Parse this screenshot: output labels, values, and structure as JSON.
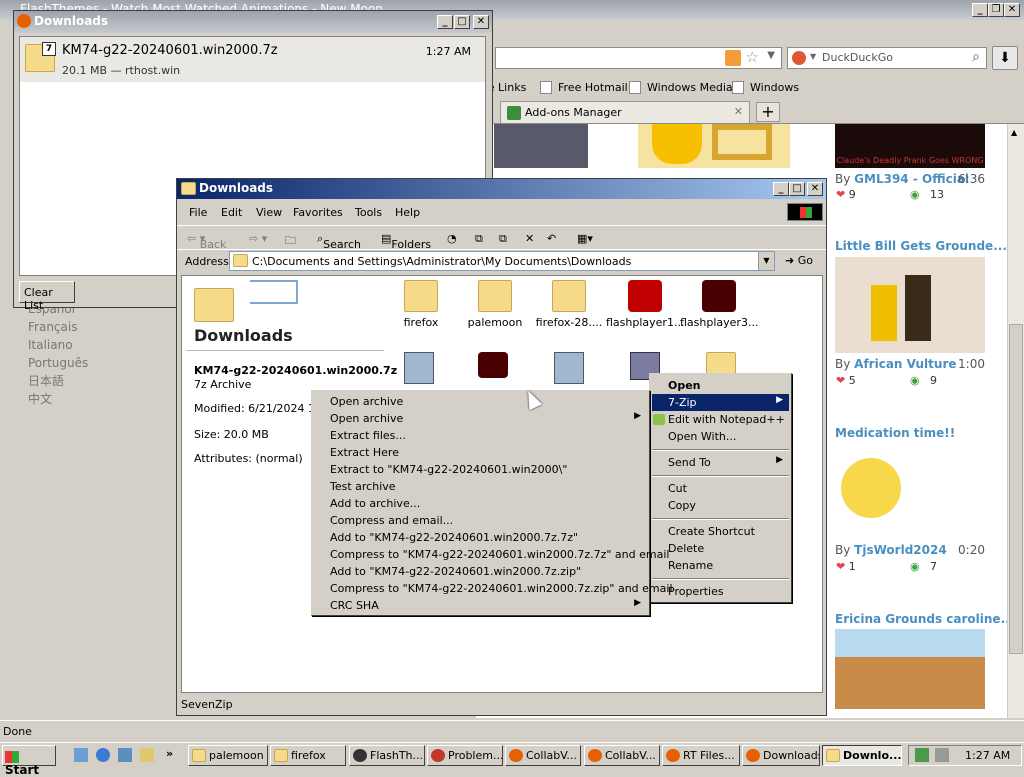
{
  "browser": {
    "title": "FlashThemes - Watch Most Watched Animations - New Moon",
    "search_placeholder": "DuckDuckGo",
    "bookmarks": [
      "ze Links",
      "Free Hotmail",
      "Windows Media",
      "Windows"
    ],
    "tab_label": "Add-ons Manager",
    "status": "Done",
    "languages": [
      "Español",
      "Français",
      "Italiano",
      "Português",
      "日本語",
      "中文"
    ],
    "right_videos": [
      {
        "title": "Claude's Deadly Prank Goes WRONG",
        "by": "GML394 - Official",
        "duration": "6:36",
        "likes": "9",
        "views": "13"
      },
      {
        "title": "Little Bill Gets Grounde...",
        "by": "African Vulture",
        "duration": "1:00",
        "likes": "5",
        "views": "9"
      },
      {
        "title": "Medication time!!",
        "by": "TjsWorld2024",
        "duration": "0:20",
        "likes": "1",
        "views": "7"
      },
      {
        "title": "Ericina Grounds caroline...",
        "by": "",
        "duration": "",
        "likes": "",
        "views": ""
      }
    ],
    "by_prefix": "By",
    "thumb_caption": "Claude's Deadly Prank Goes WRONG"
  },
  "ff_downloads": {
    "title": "Downloads",
    "item": {
      "name": "KM74-g22-20240601.win2000.7z",
      "meta": "20.1 MB — rthost.win",
      "time": "1:27 AM"
    },
    "clear_label": "Clear List"
  },
  "explorer": {
    "title": "Downloads",
    "menu": [
      "File",
      "Edit",
      "View",
      "Favorites",
      "Tools",
      "Help"
    ],
    "toolbar": {
      "back": "Back",
      "search": "Search",
      "folders": "Folders"
    },
    "address_label": "Address",
    "address": "C:\\Documents and Settings\\Administrator\\My Documents\\Downloads",
    "go": "Go",
    "panel_title": "Downloads",
    "selected": {
      "name": "KM74-g22-20240601.win2000.7z",
      "type": "7z Archive",
      "modified": "Modified: 6/21/2024 1:27",
      "size": "Size: 20.0 MB",
      "attributes": "Attributes: (normal)"
    },
    "files_row1": [
      "firefox",
      "palemoon",
      "firefox-28....",
      "flashplayer1...",
      "flashplayer3..."
    ],
    "status": "SevenZip"
  },
  "context_menu": {
    "items": [
      "Open",
      "7-Zip",
      "Edit with Notepad++",
      "Open With...",
      "Send To",
      "Cut",
      "Copy",
      "Create Shortcut",
      "Delete",
      "Rename",
      "Properties"
    ]
  },
  "zip_menu": {
    "items": [
      "Open archive",
      "Open archive",
      "Extract files...",
      "Extract Here",
      "Extract to \"KM74-g22-20240601.win2000\\\"",
      "Test archive",
      "Add to archive...",
      "Compress and email...",
      "Add to \"KM74-g22-20240601.win2000.7z.7z\"",
      "Compress to \"KM74-g22-20240601.win2000.7z.7z\" and email",
      "Add to \"KM74-g22-20240601.win2000.7z.zip\"",
      "Compress to \"KM74-g22-20240601.win2000.7z.zip\" and email",
      "CRC SHA"
    ]
  },
  "taskbar": {
    "start": "Start",
    "tasks": [
      "palemoon",
      "firefox",
      "FlashTh...",
      "Problem...",
      "CollabV...",
      "CollabV...",
      "RT Files...",
      "Downloads",
      "Downlo..."
    ],
    "clock": "1:27 AM"
  },
  "colors": {
    "title_active": "#0a246a",
    "selection": "#0a246a",
    "link": "#4a8fc2",
    "heart": "#e0475b",
    "eye": "#3aa33a"
  }
}
